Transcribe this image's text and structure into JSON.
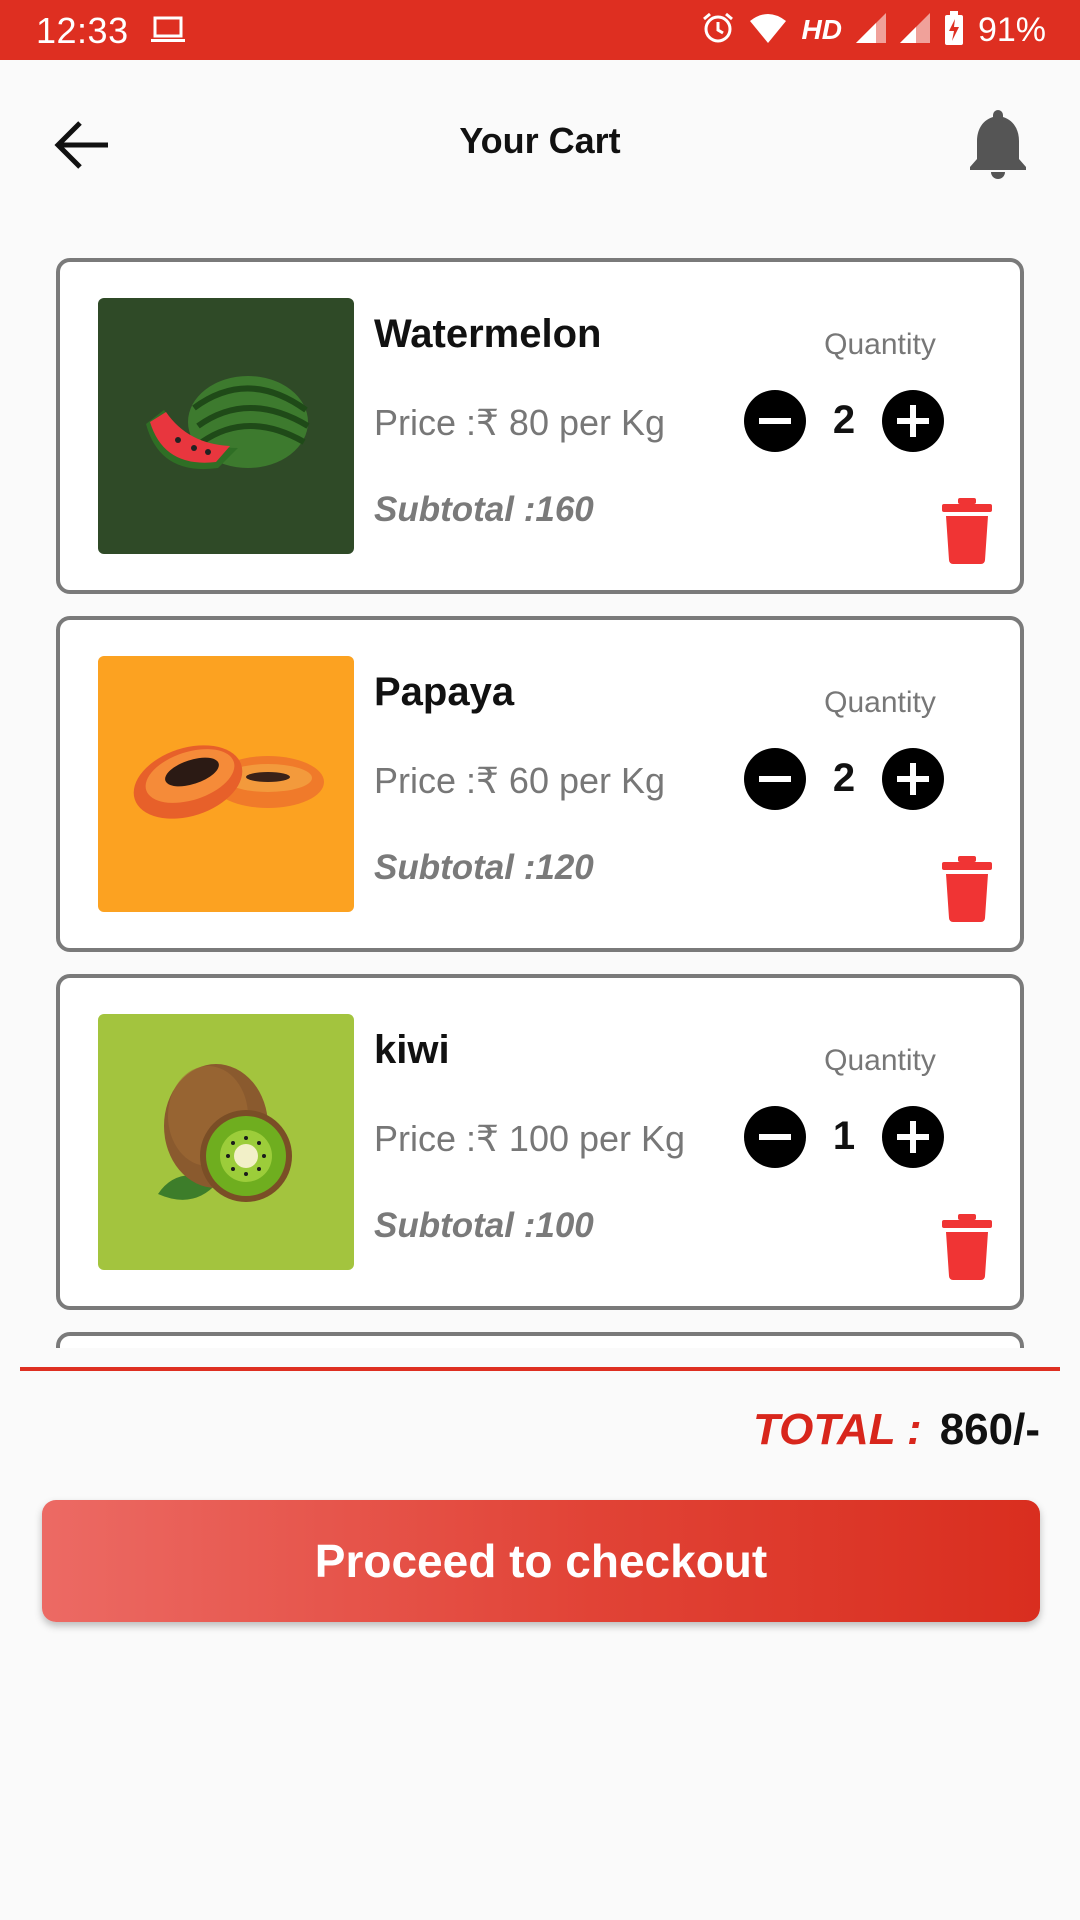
{
  "status_bar": {
    "time": "12:33",
    "network": "HD",
    "battery": "91%",
    "icons": [
      "laptop-icon",
      "alarm-icon",
      "wifi-icon",
      "signal-icon",
      "signal-icon",
      "battery-charging-icon"
    ]
  },
  "header": {
    "title": "Your Cart",
    "back_icon": "arrow-left-icon",
    "notification_icon": "bell-icon"
  },
  "cart": {
    "quantity_label": "Quantity",
    "items": [
      {
        "name": "Watermelon",
        "price": "Price :₹ 80 per Kg",
        "subtotal": "Subtotal :160",
        "quantity": "2",
        "image_bg": "#2f4a27"
      },
      {
        "name": "Papaya",
        "price": "Price :₹ 60 per Kg",
        "subtotal": "Subtotal :120",
        "quantity": "2",
        "image_bg": "#fca221"
      },
      {
        "name": "kiwi",
        "price": "Price :₹ 100 per Kg",
        "subtotal": "Subtotal :100",
        "quantity": "1",
        "image_bg": "#a3c43e"
      }
    ]
  },
  "summary": {
    "total_label": "TOTAL :",
    "total_value": "860/-"
  },
  "checkout": {
    "label": "Proceed to checkout"
  },
  "colors": {
    "accent": "#de2f21",
    "delete": "#f03434"
  }
}
